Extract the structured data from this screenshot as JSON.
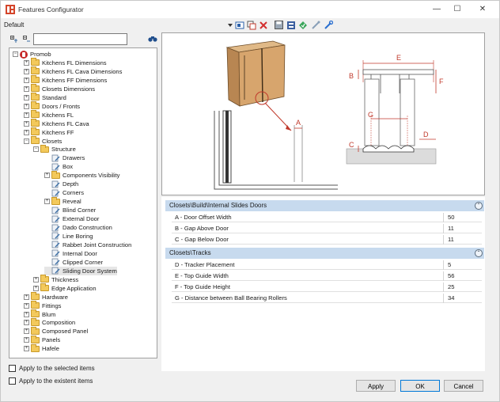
{
  "window": {
    "title": "Features Configurator",
    "controls": {
      "minimize": "—",
      "maximize": "☐",
      "close": "✕"
    }
  },
  "profile": {
    "label": "Default"
  },
  "toolbar": {
    "icons": [
      "dropdown-arrow-icon",
      "new-item-icon",
      "copy-icon",
      "delete-icon",
      "save-icon",
      "database-icon",
      "refresh-icon",
      "link-icon",
      "wrench-icon"
    ]
  },
  "tree": {
    "search_value": "",
    "items": [
      {
        "label": "Promob",
        "level": 0,
        "type": "root",
        "expanded": true
      },
      {
        "label": "Kitchens FL Dimensions",
        "level": 1,
        "type": "folder",
        "expanded": false
      },
      {
        "label": "Kitchens FL Cava Dimensions",
        "level": 1,
        "type": "folder",
        "expanded": false
      },
      {
        "label": "Kitchens FF Dimensions",
        "level": 1,
        "type": "folder",
        "expanded": false
      },
      {
        "label": "Closets Dimensions",
        "level": 1,
        "type": "folder",
        "expanded": false
      },
      {
        "label": "Standard",
        "level": 1,
        "type": "folder",
        "expanded": false
      },
      {
        "label": "Doors / Fronts",
        "level": 1,
        "type": "folder",
        "expanded": false
      },
      {
        "label": "Kitchens FL",
        "level": 1,
        "type": "folder",
        "expanded": false
      },
      {
        "label": "Kitchens FL Cava",
        "level": 1,
        "type": "folder",
        "expanded": false
      },
      {
        "label": "Kitchens FF",
        "level": 1,
        "type": "folder",
        "expanded": false
      },
      {
        "label": "Closets",
        "level": 1,
        "type": "folder",
        "expanded": true
      },
      {
        "label": "Structure",
        "level": 2,
        "type": "folder",
        "expanded": true
      },
      {
        "label": "Drawers",
        "level": 3,
        "type": "leaf"
      },
      {
        "label": "Box",
        "level": 3,
        "type": "leaf"
      },
      {
        "label": "Components Visibility",
        "level": 3,
        "type": "folder",
        "expanded": false
      },
      {
        "label": "Depth",
        "level": 3,
        "type": "leaf"
      },
      {
        "label": "Corners",
        "level": 3,
        "type": "leaf"
      },
      {
        "label": "Reveal",
        "level": 3,
        "type": "folder",
        "expanded": false
      },
      {
        "label": "Blind Corner",
        "level": 3,
        "type": "leaf"
      },
      {
        "label": "External Door",
        "level": 3,
        "type": "leaf"
      },
      {
        "label": "Dado Construction",
        "level": 3,
        "type": "leaf"
      },
      {
        "label": "Line Boring",
        "level": 3,
        "type": "leaf"
      },
      {
        "label": "Rabbet Joint Construction",
        "level": 3,
        "type": "leaf"
      },
      {
        "label": "Internal Door",
        "level": 3,
        "type": "leaf"
      },
      {
        "label": "Clipped Corner",
        "level": 3,
        "type": "leaf"
      },
      {
        "label": "Sliding Door System",
        "level": 3,
        "type": "leaf",
        "selected": true
      },
      {
        "label": "Thickness",
        "level": 2,
        "type": "folder",
        "expanded": false
      },
      {
        "label": "Edge Application",
        "level": 2,
        "type": "folder",
        "expanded": false
      },
      {
        "label": "Hardware",
        "level": 1,
        "type": "folder",
        "expanded": false
      },
      {
        "label": "Fittings",
        "level": 1,
        "type": "folder",
        "expanded": false
      },
      {
        "label": "Blum",
        "level": 1,
        "type": "folder",
        "expanded": false
      },
      {
        "label": "Composition",
        "level": 1,
        "type": "folder",
        "expanded": false
      },
      {
        "label": "Composed Panel",
        "level": 1,
        "type": "folder",
        "expanded": false
      },
      {
        "label": "Panels",
        "level": 1,
        "type": "folder",
        "expanded": false
      },
      {
        "label": "Hafele",
        "level": 1,
        "type": "folder",
        "expanded": false
      }
    ]
  },
  "options": {
    "apply_selected": "Apply to the selected items",
    "apply_existent": "Apply to the existent items"
  },
  "preview": {
    "labels": {
      "a": "A",
      "b": "B",
      "c": "C",
      "d": "D",
      "e": "E",
      "f": "F",
      "g": "G"
    }
  },
  "sections": [
    {
      "title": "Closets\\Build\\Internal Slides Doors",
      "rows": [
        {
          "name": "A - Door Offset Width",
          "value": "50"
        },
        {
          "name": "B - Gap Above Door",
          "value": "11"
        },
        {
          "name": "C - Gap Below Door",
          "value": "11"
        }
      ]
    },
    {
      "title": "Closets\\Tracks",
      "rows": [
        {
          "name": "D -  Tracker Placement",
          "value": "5"
        },
        {
          "name": "E -  Top Guide Width",
          "value": "56"
        },
        {
          "name": "F -  Top Guide Height",
          "value": "25"
        },
        {
          "name": "G -  Distance between Ball Bearing Rollers",
          "value": "34"
        }
      ]
    }
  ],
  "buttons": {
    "apply": "Apply",
    "ok": "OK",
    "cancel": "Cancel"
  },
  "colors": {
    "accent": "#0078d7",
    "section_header": "#c7daee",
    "folder": "#f3c95b",
    "dimension": "#c0392b"
  }
}
